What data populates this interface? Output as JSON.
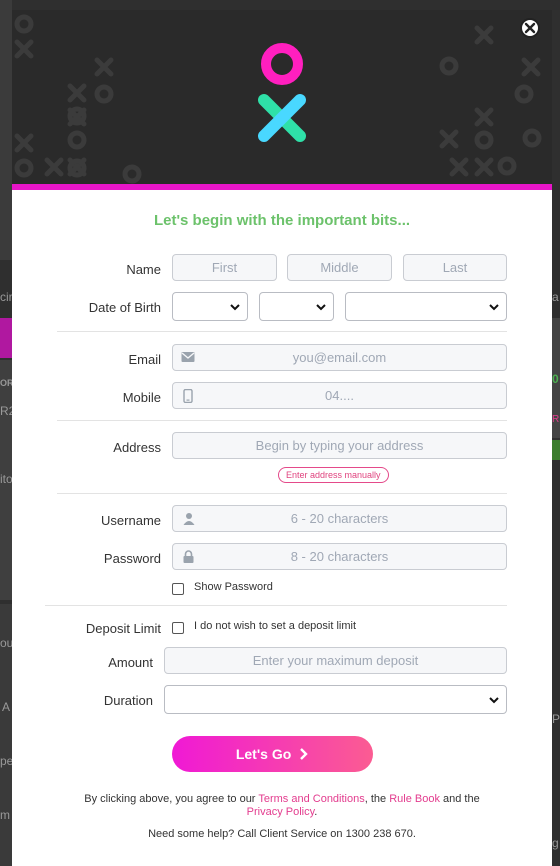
{
  "backdrop": {
    "left_fragments": [
      "cir",
      "OR",
      "R2",
      "ito",
      "ou",
      "A",
      "pe",
      "m"
    ],
    "right_fragments": [
      "a",
      "0",
      "R",
      "Pe",
      "g"
    ]
  },
  "modal": {
    "close_icon": "close-circle-icon",
    "logo_icon": "ox-logo-icon",
    "heading": "Let's begin with the important bits...",
    "name": {
      "label": "Name",
      "first_placeholder": "First",
      "middle_placeholder": "Middle",
      "last_placeholder": "Last"
    },
    "dob": {
      "label": "Date of Birth"
    },
    "email": {
      "label": "Email",
      "placeholder": "you@email.com",
      "icon": "envelope-icon"
    },
    "mobile": {
      "label": "Mobile",
      "placeholder": "04....",
      "icon": "phone-icon"
    },
    "address": {
      "label": "Address",
      "placeholder": "Begin by typing your address",
      "manual_link": "Enter address manually"
    },
    "username": {
      "label": "Username",
      "placeholder": "6 - 20 characters",
      "icon": "user-icon"
    },
    "password": {
      "label": "Password",
      "placeholder": "8 - 20 characters",
      "icon": "lock-icon"
    },
    "show_password": "Show Password",
    "deposit_limit": {
      "label": "Deposit Limit",
      "checkbox_label": "I do not wish to set a deposit limit"
    },
    "amount": {
      "label": "Amount",
      "placeholder": "Enter your maximum deposit"
    },
    "duration": {
      "label": "Duration"
    },
    "submit": "Let's Go",
    "terms": {
      "prefix": "By clicking above, you agree to our ",
      "terms_link": "Terms and Conditions",
      "middle": ", the ",
      "rule_link": "Rule Book",
      "and": " and the",
      "privacy_link": "Privacy Policy",
      "suffix": "."
    },
    "help": "Need some help? Call Client Service on 1300 238 670.",
    "colors": {
      "accent_pink": "#e815c9",
      "heading_green": "#6cc26b",
      "link_pink": "#e33c8e"
    }
  }
}
